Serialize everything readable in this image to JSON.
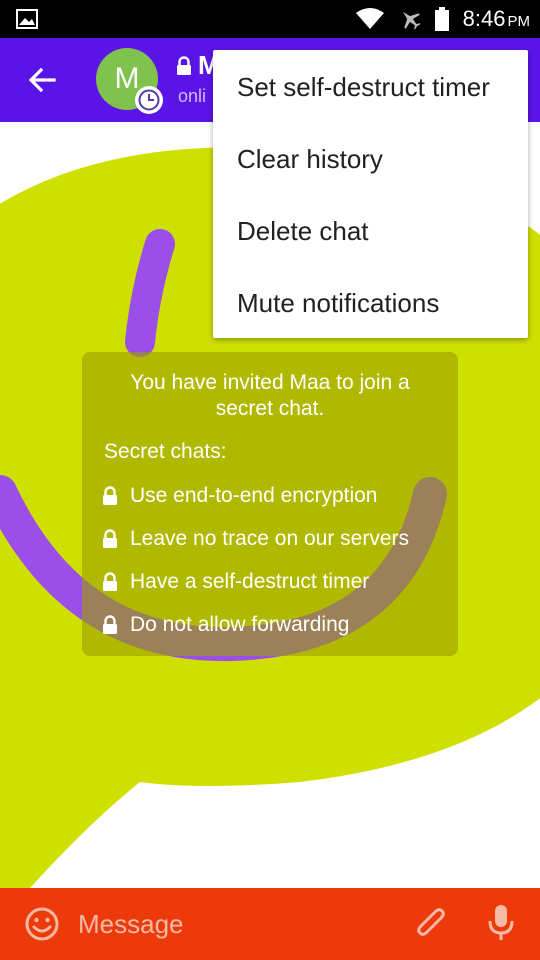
{
  "status_bar": {
    "time": "8:46",
    "ampm": "PM",
    "icons": [
      "gallery-icon",
      "wifi-icon",
      "airplane-icon",
      "battery-icon"
    ]
  },
  "header": {
    "avatar_letter": "M",
    "name": "M",
    "status": "onli",
    "icons": [
      "back-arrow-icon",
      "lock-icon",
      "clock-icon"
    ]
  },
  "menu": {
    "items": [
      {
        "label": "Set self-destruct timer"
      },
      {
        "label": "Clear history"
      },
      {
        "label": "Delete chat"
      },
      {
        "label": "Mute notifications"
      }
    ]
  },
  "info_card": {
    "title": "You have invited Maa to join a secret chat.",
    "subtitle": "Secret chats:",
    "items": [
      {
        "label": "Use end-to-end encryption"
      },
      {
        "label": "Leave no trace on our servers"
      },
      {
        "label": "Have a self-destruct timer"
      },
      {
        "label": "Do not allow forwarding"
      }
    ]
  },
  "input_bar": {
    "placeholder": "Message",
    "icons": [
      "emoji-icon",
      "paperclip-icon",
      "microphone-icon"
    ]
  },
  "colors": {
    "header": "#5a14e8",
    "input_bar": "#ec3a0a",
    "avatar": "#7fc24d",
    "bubble": "#cfe000",
    "smile": "#9b4fe8"
  }
}
